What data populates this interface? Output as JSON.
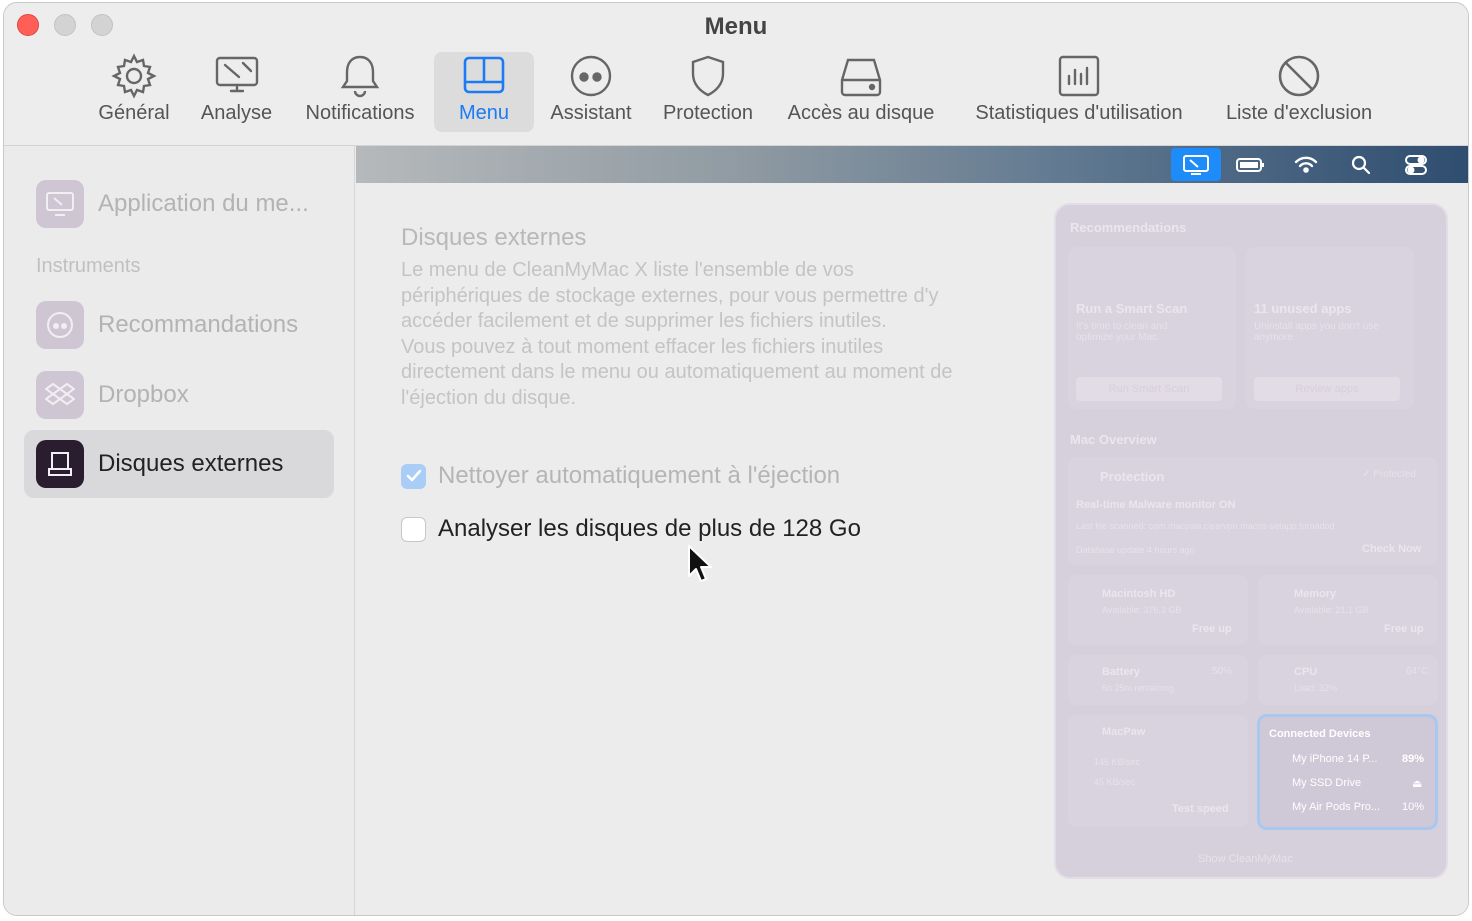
{
  "window": {
    "title": "Menu"
  },
  "toolbar": {
    "items": [
      {
        "label": "Général",
        "icon": "gear-icon"
      },
      {
        "label": "Analyse",
        "icon": "monitor-scan-icon"
      },
      {
        "label": "Notifications",
        "icon": "bell-icon"
      },
      {
        "label": "Menu",
        "icon": "menu-panel-icon",
        "active": true
      },
      {
        "label": "Assistant",
        "icon": "assistant-icon"
      },
      {
        "label": "Protection",
        "icon": "shield-icon"
      },
      {
        "label": "Accès au disque",
        "icon": "disk-icon"
      },
      {
        "label": "Statistiques d'utilisation",
        "icon": "stats-chart-icon"
      },
      {
        "label": "Liste d'exclusion",
        "icon": "prohibited-icon"
      }
    ],
    "accent": "#1b7bf5"
  },
  "sidebar": {
    "top_item": {
      "label": "Application du me...",
      "icon": "menu-app-icon"
    },
    "section": "Instruments",
    "items": [
      {
        "label": "Recommandations",
        "icon": "recommendations-icon"
      },
      {
        "label": "Dropbox",
        "icon": "dropbox-icon"
      },
      {
        "label": "Disques externes",
        "icon": "external-disk-icon",
        "selected": true
      }
    ]
  },
  "menubar": {
    "icons": [
      "cleanmymac-menu-icon",
      "battery-icon",
      "wifi-icon",
      "search-icon",
      "control-center-icon"
    ],
    "active_color": "#1d8cf8"
  },
  "main": {
    "title": "Disques externes",
    "description": "Le menu de CleanMyMac X liste l'ensemble de vos périphériques de stockage externes, pour vous permettre d'y accéder facilement et de supprimer les fichiers inutiles.\nVous pouvez à tout moment effacer les fichiers inutiles directement dans le menu ou automatiquement au moment de l'éjection du disque.",
    "options": [
      {
        "label": "Nettoyer automatiquement à l'éjection",
        "checked": true,
        "disabled": true
      },
      {
        "label": "Analyser les disques de plus de 128 Go",
        "checked": false,
        "disabled": false
      }
    ]
  },
  "preview": {
    "recommendations_title": "Recommendations",
    "cards": [
      {
        "title": "Run a Smart Scan",
        "subtitle": "It's time to clean and optimize your Mac.",
        "button": "Run Smart Scan"
      },
      {
        "title": "11 unused apps",
        "subtitle": "Uninstall apps you don't use anymore",
        "button": "Review apps"
      }
    ],
    "overview_title": "Mac Overview",
    "protection": {
      "title": "Protection",
      "status": "✓ Protected",
      "headline": "Real-time Malware monitor ON",
      "last_scanned": "Last file scanned: com.macpaw.clearvpn.macos-setapp.tornadod",
      "db_update": "Database update 4 hours ago",
      "action": "Check Now"
    },
    "disk": {
      "title": "Macintosh HD",
      "sub": "Available: 376,3 GB",
      "action": "Free up"
    },
    "memory": {
      "title": "Memory",
      "sub": "Available: 21,1 GB",
      "action": "Free up"
    },
    "battery": {
      "title": "Battery",
      "sub": "6h 25m remaining",
      "value": "50%"
    },
    "cpu": {
      "title": "CPU",
      "sub": "Load: 32%",
      "value": "64°C"
    },
    "network": {
      "title": "MacPaw",
      "up": "145 KB/sec",
      "down": "45 KB/sec",
      "action": "Test speed"
    },
    "connected": {
      "title": "Connected Devices",
      "devices": [
        {
          "name": "My iPhone 14 P...",
          "value": "89%"
        },
        {
          "name": "My SSD Drive",
          "value": "⏏"
        },
        {
          "name": "My Air Pods Pro...",
          "value": "10%"
        }
      ]
    },
    "footer": "Show CleanMyMac"
  }
}
